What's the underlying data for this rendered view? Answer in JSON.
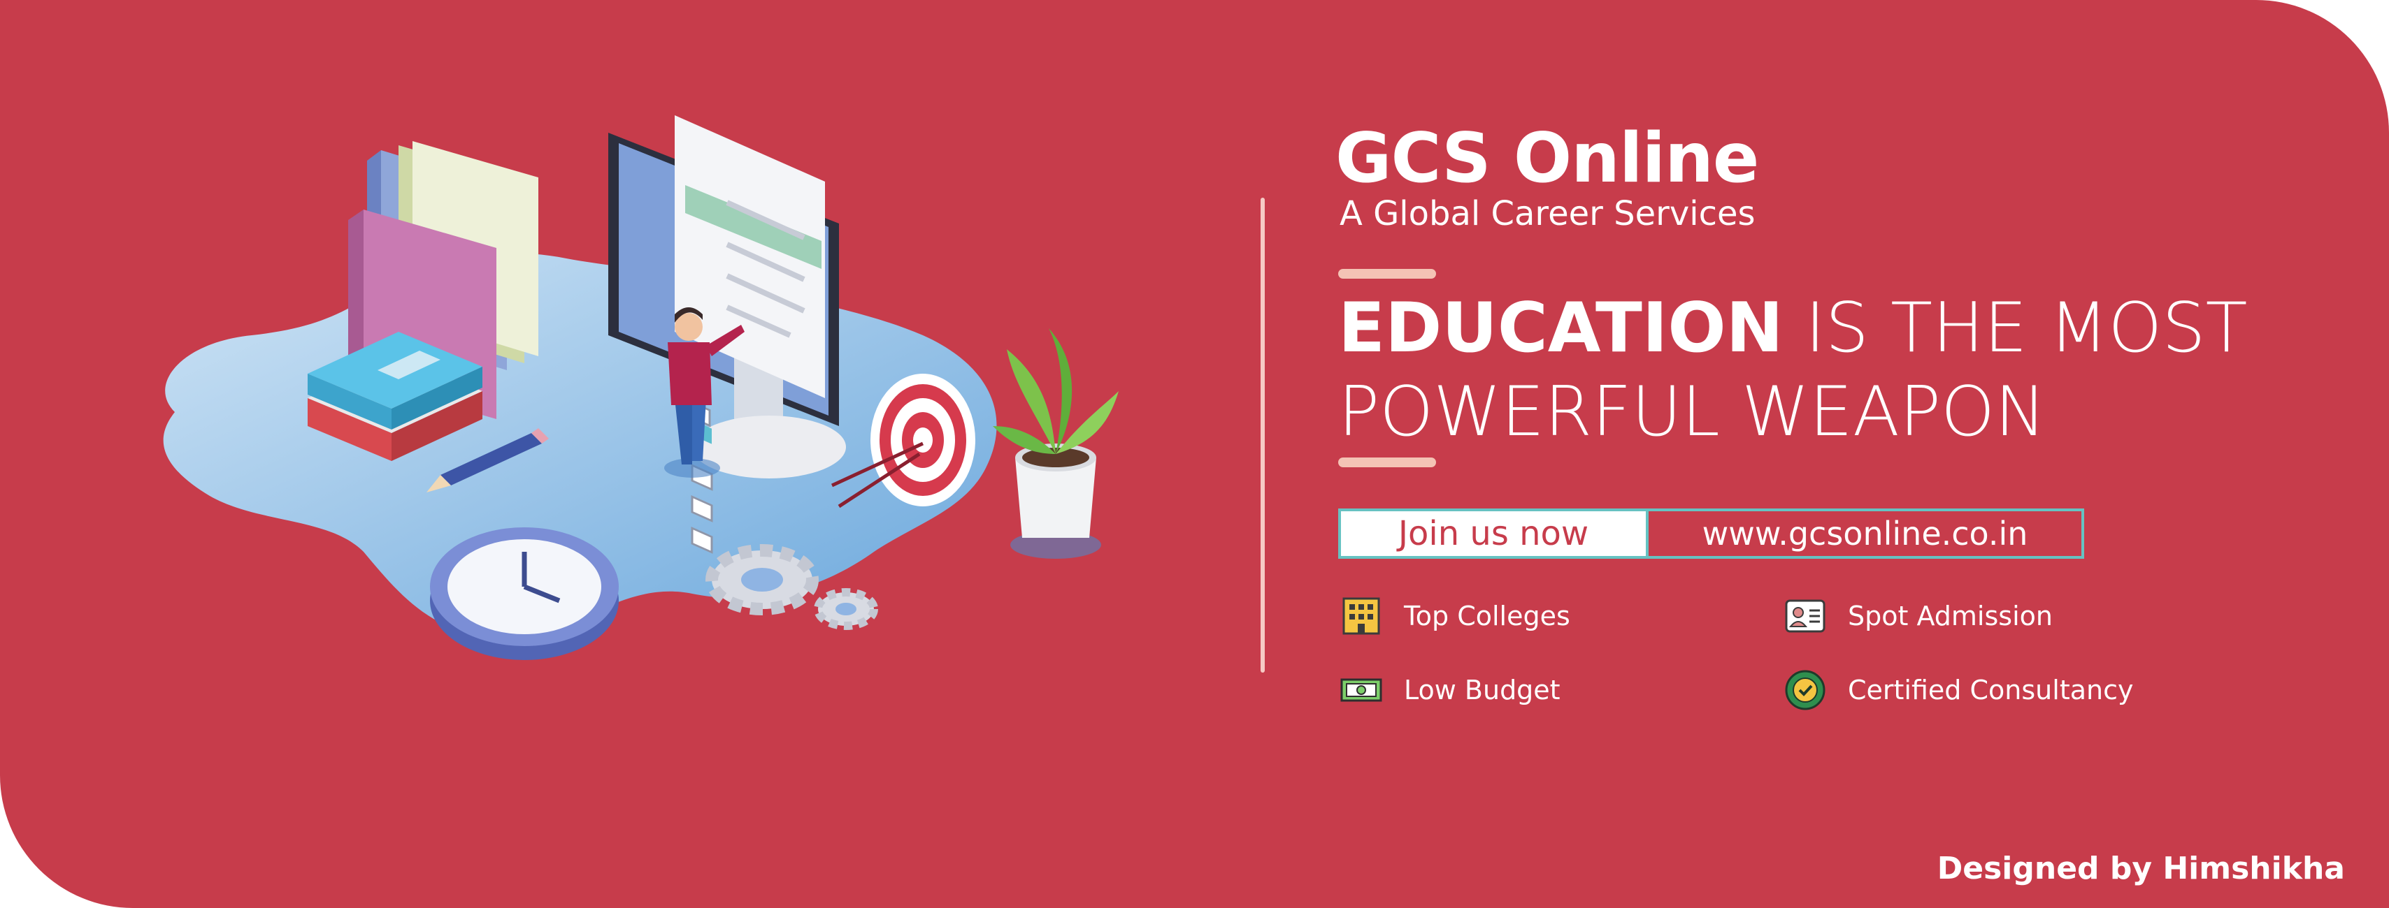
{
  "brand": {
    "name": "GCS Online",
    "tagline": "A Global Career Services"
  },
  "headline": {
    "emphasis": "EDUCATION",
    "line1_rest": " IS THE MOST",
    "line2": "POWERFUL WEAPON"
  },
  "cta": {
    "join_label": "Join us now",
    "url": "www.gcsonline.co.in"
  },
  "features": [
    {
      "label": "Top Colleges",
      "icon": "building-icon"
    },
    {
      "label": "Spot Admission",
      "icon": "id-card-icon"
    },
    {
      "label": "Low Budget",
      "icon": "money-icon"
    },
    {
      "label": "Certified Consultancy",
      "icon": "certified-badge-icon"
    }
  ],
  "credit": "Designed by Himshikha",
  "colors": {
    "background": "#c73c4b",
    "accent": "#f4c3b5",
    "cta_border": "#66c2c2",
    "white": "#ffffff"
  }
}
